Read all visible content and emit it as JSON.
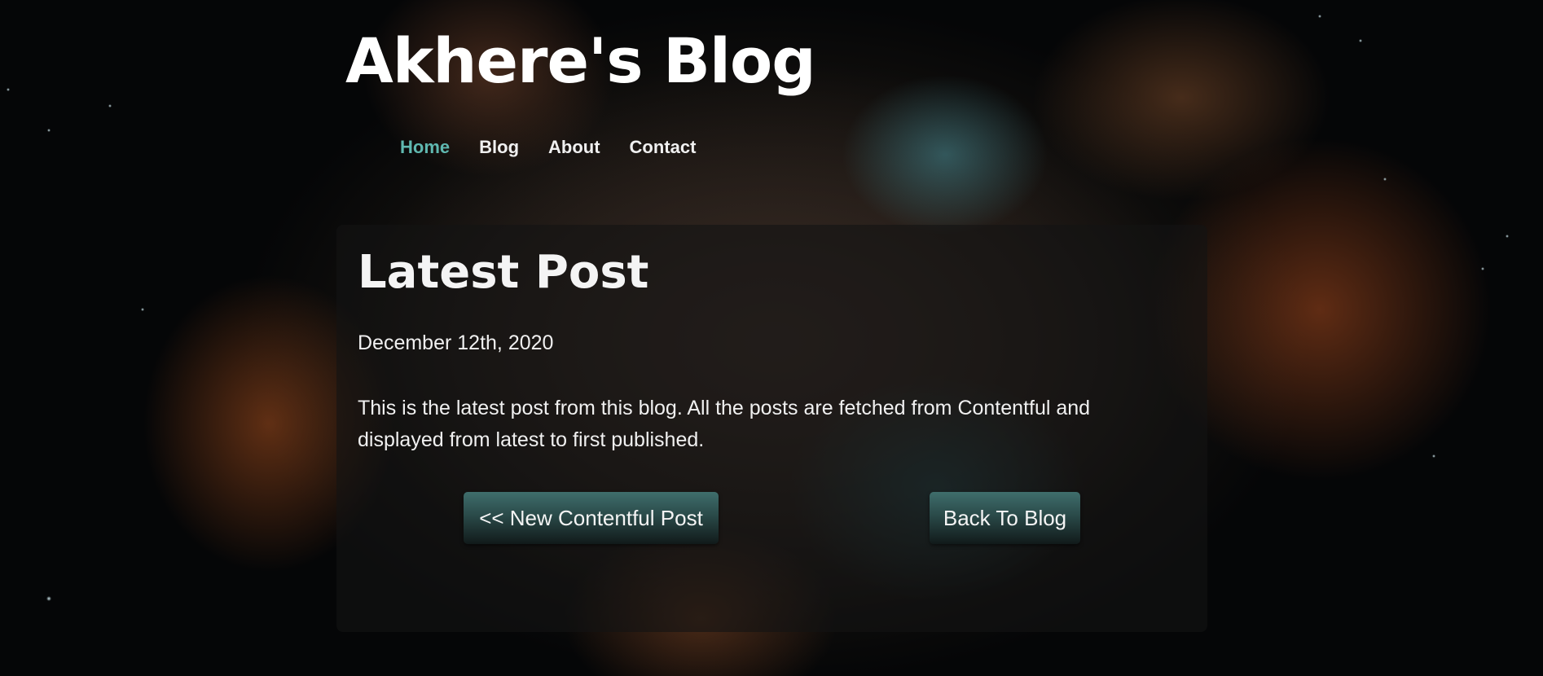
{
  "site": {
    "title": "Akhere's Blog"
  },
  "nav": {
    "items": [
      {
        "label": "Home",
        "active": true
      },
      {
        "label": "Blog",
        "active": false
      },
      {
        "label": "About",
        "active": false
      },
      {
        "label": "Contact",
        "active": false
      }
    ]
  },
  "post": {
    "heading": "Latest Post",
    "date": "December 12th, 2020",
    "body": "This is the latest post from this blog. All the posts are fetched from Contentful and displayed from latest to first published."
  },
  "buttons": {
    "new_post": "<< New Contentful Post",
    "back": "Back To Blog"
  },
  "colors": {
    "active_nav": "#5fb8b0",
    "button_top": "#3f6e6c",
    "button_bottom": "#111a1a",
    "card_background": "rgba(20,20,20,0.62)"
  }
}
